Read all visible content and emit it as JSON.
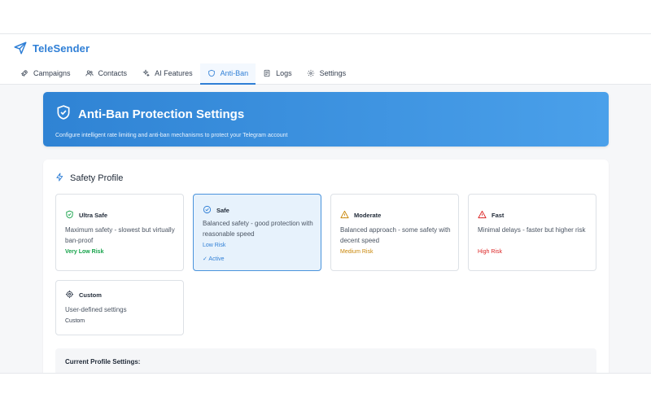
{
  "app": {
    "name": "TeleSender",
    "logo_icon": "paper-plane-icon",
    "brand_color": "#2f7fd6"
  },
  "tabs": [
    {
      "label": "Campaigns",
      "icon": "rocket-icon",
      "active": false
    },
    {
      "label": "Contacts",
      "icon": "users-icon",
      "active": false
    },
    {
      "label": "AI Features",
      "icon": "sparkles-icon",
      "active": false
    },
    {
      "label": "Anti-Ban",
      "icon": "shield-icon",
      "active": true
    },
    {
      "label": "Logs",
      "icon": "document-icon",
      "active": false
    },
    {
      "label": "Settings",
      "icon": "gear-icon",
      "active": false
    }
  ],
  "hero": {
    "title": "Anti-Ban Protection Settings",
    "subtitle": "Configure intelligent rate limiting and anti-ban mechanisms to protect your Telegram account",
    "icon": "shield-check-icon"
  },
  "safety_profile": {
    "title": "Safety Profile",
    "icon": "lightning-icon",
    "profiles": [
      {
        "name": "Ultra Safe",
        "icon": "shield-check-icon",
        "description": "Maximum safety - slowest but virtually ban-proof",
        "risk": "Very Low Risk",
        "risk_color": "#16a34a",
        "selected": false
      },
      {
        "name": "Safe",
        "icon": "check-circle-icon",
        "description": "Balanced safety - good protection with reasonable speed",
        "risk": "Low Risk",
        "risk_color": "#2f7fd6",
        "selected": true,
        "active_label": "✓ Active"
      },
      {
        "name": "Moderate",
        "icon": "warning-icon",
        "description": "Balanced approach - some safety with decent speed",
        "risk": "Medium Risk",
        "risk_color": "#c9870a",
        "selected": false
      },
      {
        "name": "Fast",
        "icon": "alert-triangle-icon",
        "description": "Minimal delays - faster but higher risk",
        "risk": "High Risk",
        "risk_color": "#dc2626",
        "selected": false
      },
      {
        "name": "Custom",
        "icon": "settings-cog-icon",
        "description": "User-defined settings",
        "risk": "Custom",
        "risk_color": "#374151",
        "selected": false
      }
    ]
  },
  "current_profile": {
    "label": "Current Profile Settings:"
  }
}
